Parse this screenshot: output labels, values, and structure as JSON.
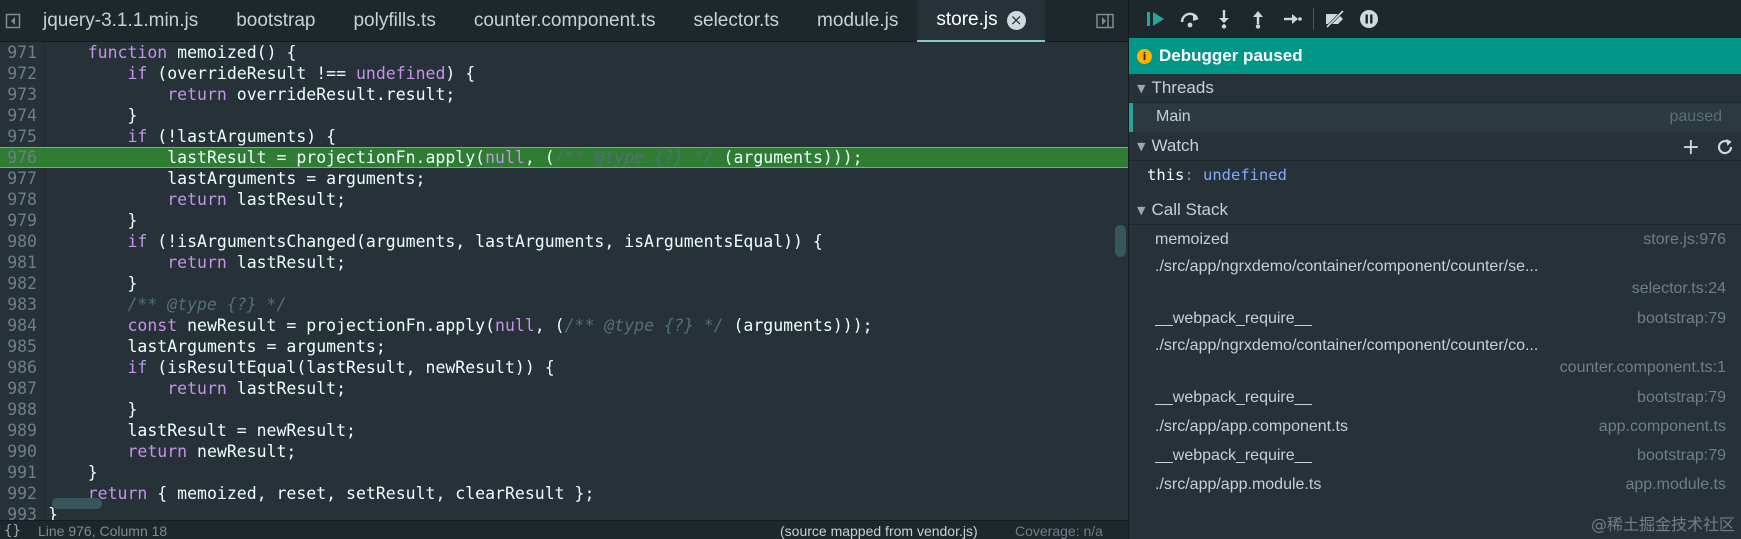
{
  "editor": {
    "tabs": [
      {
        "label": "jquery-3.1.1.min.js",
        "active": false
      },
      {
        "label": "bootstrap",
        "active": false
      },
      {
        "label": "polyfills.ts",
        "active": false
      },
      {
        "label": "counter.component.ts",
        "active": false
      },
      {
        "label": "selector.ts",
        "active": false
      },
      {
        "label": "module.js",
        "active": false
      },
      {
        "label": "store.js",
        "active": true
      }
    ],
    "active_line": 976,
    "lines": [
      {
        "n": "971",
        "segments": [
          [
            "t",
            "    "
          ],
          [
            "kw",
            "function"
          ],
          [
            "t",
            " memoized() {"
          ]
        ]
      },
      {
        "n": "972",
        "segments": [
          [
            "t",
            "        "
          ],
          [
            "kw",
            "if"
          ],
          [
            "t",
            " (overrideResult !== "
          ],
          [
            "lit",
            "undefined"
          ],
          [
            "t",
            ") {"
          ]
        ]
      },
      {
        "n": "973",
        "segments": [
          [
            "t",
            "            "
          ],
          [
            "kw",
            "return"
          ],
          [
            "t",
            " overrideResult.result;"
          ]
        ]
      },
      {
        "n": "974",
        "segments": [
          [
            "t",
            "        }"
          ]
        ]
      },
      {
        "n": "975",
        "segments": [
          [
            "t",
            "        "
          ],
          [
            "kw",
            "if"
          ],
          [
            "t",
            " (!lastArguments) {"
          ]
        ]
      },
      {
        "n": "976",
        "segments": [
          [
            "t",
            "            lastResult = projectionFn.apply("
          ],
          [
            "lit",
            "null"
          ],
          [
            "t",
            ", ("
          ],
          [
            "cm",
            "/** @type {?} */"
          ],
          [
            "t",
            " (arguments)));"
          ]
        ]
      },
      {
        "n": "977",
        "segments": [
          [
            "t",
            "            lastArguments = arguments;"
          ]
        ]
      },
      {
        "n": "978",
        "segments": [
          [
            "t",
            "            "
          ],
          [
            "kw",
            "return"
          ],
          [
            "t",
            " lastResult;"
          ]
        ]
      },
      {
        "n": "979",
        "segments": [
          [
            "t",
            "        }"
          ]
        ]
      },
      {
        "n": "980",
        "segments": [
          [
            "t",
            "        "
          ],
          [
            "kw",
            "if"
          ],
          [
            "t",
            " (!isArgumentsChanged(arguments, lastArguments, isArgumentsEqual)) {"
          ]
        ]
      },
      {
        "n": "981",
        "segments": [
          [
            "t",
            "            "
          ],
          [
            "kw",
            "return"
          ],
          [
            "t",
            " lastResult;"
          ]
        ]
      },
      {
        "n": "982",
        "segments": [
          [
            "t",
            "        }"
          ]
        ]
      },
      {
        "n": "983",
        "segments": [
          [
            "t",
            "        "
          ],
          [
            "cm",
            "/** @type {?} */"
          ]
        ]
      },
      {
        "n": "984",
        "segments": [
          [
            "t",
            "        "
          ],
          [
            "kw",
            "const"
          ],
          [
            "t",
            " newResult = projectionFn.apply("
          ],
          [
            "lit",
            "null"
          ],
          [
            "t",
            ", ("
          ],
          [
            "cm",
            "/** @type {?} */"
          ],
          [
            "t",
            " (arguments)));"
          ]
        ]
      },
      {
        "n": "985",
        "segments": [
          [
            "t",
            "        lastArguments = arguments;"
          ]
        ]
      },
      {
        "n": "986",
        "segments": [
          [
            "t",
            "        "
          ],
          [
            "kw",
            "if"
          ],
          [
            "t",
            " (isResultEqual(lastResult, newResult)) {"
          ]
        ]
      },
      {
        "n": "987",
        "segments": [
          [
            "t",
            "            "
          ],
          [
            "kw",
            "return"
          ],
          [
            "t",
            " lastResult;"
          ]
        ]
      },
      {
        "n": "988",
        "segments": [
          [
            "t",
            "        }"
          ]
        ]
      },
      {
        "n": "989",
        "segments": [
          [
            "t",
            "        lastResult = newResult;"
          ]
        ]
      },
      {
        "n": "990",
        "segments": [
          [
            "t",
            "        "
          ],
          [
            "kw",
            "return"
          ],
          [
            "t",
            " newResult;"
          ]
        ]
      },
      {
        "n": "991",
        "segments": [
          [
            "t",
            "    }"
          ]
        ]
      },
      {
        "n": "992",
        "segments": [
          [
            "t",
            "    "
          ],
          [
            "kw",
            "return"
          ],
          [
            "t",
            " { memoized, reset, setResult, clearResult };"
          ]
        ]
      },
      {
        "n": "993",
        "segments": [
          [
            "t",
            "}"
          ]
        ]
      }
    ]
  },
  "statusbar": {
    "format_glyph": "{}",
    "position": "Line 976, Column 18",
    "source_mapped": "(source mapped from vendor.js)",
    "coverage": "Coverage: n/a"
  },
  "debugger": {
    "toolbar_icons": [
      "resume-icon",
      "step-over-icon",
      "step-into-icon",
      "step-out-icon",
      "step-icon",
      "deactivate-breakpoints-icon",
      "pause-on-exceptions-icon"
    ],
    "paused_label": "Debugger paused",
    "threads": {
      "header": "Threads",
      "items": [
        {
          "name": "Main",
          "state": "paused"
        }
      ]
    },
    "watch": {
      "header": "Watch",
      "expressions": [
        {
          "name": "this",
          "value": "undefined"
        }
      ]
    },
    "call_stack": {
      "header": "Call Stack",
      "frames": [
        {
          "name": "memoized",
          "location": "store.js:976",
          "layout": "single"
        },
        {
          "name": "./src/app/ngrxdemo/container/component/counter/se...",
          "location": "selector.ts:24",
          "layout": "double"
        },
        {
          "name": "__webpack_require__",
          "location": "bootstrap:79",
          "layout": "single"
        },
        {
          "name": "./src/app/ngrxdemo/container/component/counter/co...",
          "location": "counter.component.ts:1",
          "layout": "double"
        },
        {
          "name": "__webpack_require__",
          "location": "bootstrap:79",
          "layout": "single"
        },
        {
          "name": "./src/app/app.component.ts",
          "location": "app.component.ts",
          "layout": "single"
        },
        {
          "name": "__webpack_require__",
          "location": "bootstrap:79",
          "layout": "single"
        },
        {
          "name": "./src/app/app.module.ts",
          "location": "app.module.ts",
          "layout": "single"
        }
      ]
    }
  },
  "watermark": "@稀土掘金技术社区",
  "colors": {
    "accent": "#009688",
    "active_line": "#2e7d32",
    "background": "#263238"
  }
}
